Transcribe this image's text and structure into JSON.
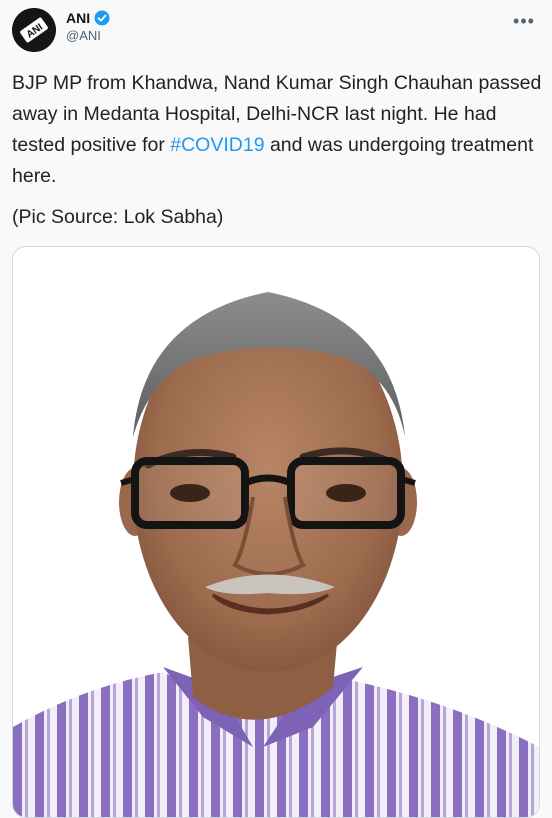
{
  "author": {
    "display_name": "ANI",
    "handle": "@ANI",
    "avatar_icon": "ani-logo-icon",
    "verified_icon": "verified-badge-icon"
  },
  "menu": {
    "more_label": "•••"
  },
  "tweet": {
    "text_before_hashtag": "BJP MP from Khandwa, Nand Kumar Singh Chauhan passed away in Medanta Hospital, Delhi-NCR last night. He had tested positive for ",
    "hashtag": "#COVID19",
    "text_after_hashtag": " and was undergoing treatment here.",
    "source": "(Pic Source: Lok Sabha)"
  },
  "media": {
    "type": "photo",
    "alt_icon": "portrait-photo"
  },
  "colors": {
    "link": "#1d9bf0",
    "verified": "#1d9bf0",
    "background": "#f9f9f9",
    "border": "#cfd9de"
  }
}
